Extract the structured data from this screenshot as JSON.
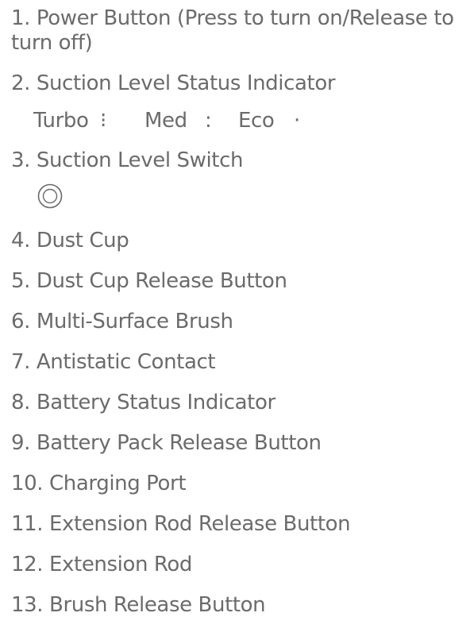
{
  "items": [
    {
      "label": "1. Power Button (Press to turn on/Release to turn off)"
    },
    {
      "label": "2. Suction Level Status Indicator"
    },
    {
      "label": "3. Suction Level Switch"
    },
    {
      "label": "4. Dust Cup"
    },
    {
      "label": "5. Dust Cup Release Button"
    },
    {
      "label": "6. Multi-Surface Brush"
    },
    {
      "label": "7. Antistatic Contact"
    },
    {
      "label": "8. Battery Status Indicator"
    },
    {
      "label": "9. Battery Pack Release Button"
    },
    {
      "label": "10. Charging Port"
    },
    {
      "label": "11. Extension Rod Release Button"
    },
    {
      "label": "12. Extension Rod"
    },
    {
      "label": "13. Brush Release Button"
    }
  ],
  "suction_levels": {
    "turbo": {
      "label": "Turbo",
      "indicator": "⁝"
    },
    "med": {
      "label": "Med",
      "indicator": ":"
    },
    "eco": {
      "label": "Eco",
      "indicator": "·"
    }
  },
  "icons": {
    "suction_switch": "concentric-circle-switch-icon"
  },
  "colors": {
    "text": "#6b6b6b",
    "background": "#ffffff"
  }
}
